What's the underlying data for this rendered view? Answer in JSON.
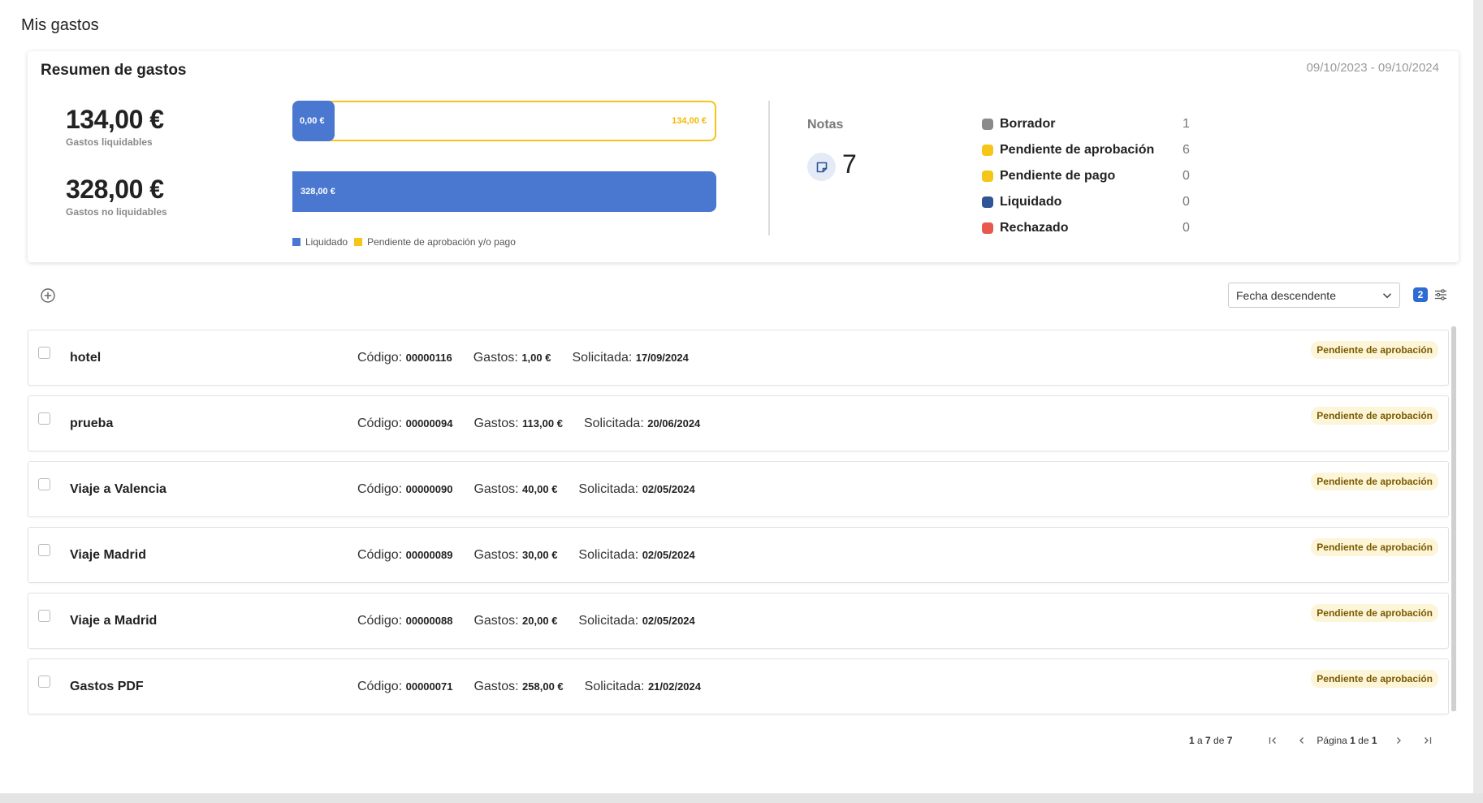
{
  "page": {
    "title": "Mis gastos"
  },
  "summary": {
    "title": "Resumen de gastos",
    "date_range": "09/10/2023 - 09/10/2024",
    "liquidables": {
      "amount": "134,00 €",
      "label": "Gastos liquidables"
    },
    "no_liquidables": {
      "amount": "328,00 €",
      "label": "Gastos no liquidables"
    },
    "bar1": {
      "fill_label": "0,00 €",
      "end_label": "134,00 €",
      "fill_value": 0,
      "total_value": 134
    },
    "bar2": {
      "fill_label": "328,00 €",
      "fill_value": 328,
      "total_value": 328
    },
    "legend": [
      {
        "label": "Liquidado",
        "color": "#4a78d0"
      },
      {
        "label": "Pendiente de aprobación y/o pago",
        "color": "#f5c518"
      }
    ],
    "notas": {
      "label": "Notas",
      "count": "7",
      "icon": "note-icon"
    },
    "statuses": [
      {
        "name": "Borrador",
        "count": "1",
        "color": "#8a8a8a"
      },
      {
        "name": "Pendiente de aprobación",
        "count": "6",
        "color": "#f5c518"
      },
      {
        "name": "Pendiente de pago",
        "count": "0",
        "color": "#f5c518"
      },
      {
        "name": "Liquidado",
        "count": "0",
        "color": "#2f5597"
      },
      {
        "name": "Rechazado",
        "count": "0",
        "color": "#e8584f"
      }
    ]
  },
  "toolbar": {
    "add_icon": "plus-circle-icon",
    "sort_value": "Fecha descendente",
    "filter_count": "2",
    "filter_icon": "sliders-icon"
  },
  "labels": {
    "code": "Código:",
    "expenses": "Gastos:",
    "requested": "Solicitada:"
  },
  "items": [
    {
      "title": "hotel",
      "code": "00000116",
      "expenses": "1,00 €",
      "requested": "17/09/2024",
      "status": "Pendiente de aprobación"
    },
    {
      "title": "prueba",
      "code": "00000094",
      "expenses": "113,00 €",
      "requested": "20/06/2024",
      "status": "Pendiente de aprobación"
    },
    {
      "title": "Viaje a Valencia",
      "code": "00000090",
      "expenses": "40,00 €",
      "requested": "02/05/2024",
      "status": "Pendiente de aprobación"
    },
    {
      "title": "Viaje Madrid",
      "code": "00000089",
      "expenses": "30,00 €",
      "requested": "02/05/2024",
      "status": "Pendiente de aprobación"
    },
    {
      "title": "Viaje a Madrid",
      "code": "00000088",
      "expenses": "20,00 €",
      "requested": "02/05/2024",
      "status": "Pendiente de aprobación"
    },
    {
      "title": "Gastos PDF",
      "code": "00000071",
      "expenses": "258,00 €",
      "requested": "21/02/2024",
      "status": "Pendiente de aprobación"
    }
  ],
  "pagination": {
    "range_start": "1",
    "range_mid": " a ",
    "range_end": "7",
    "range_de": " de ",
    "range_total": "7",
    "page_label": "Página ",
    "page_current": "1",
    "page_of": " de ",
    "page_total": "1"
  }
}
